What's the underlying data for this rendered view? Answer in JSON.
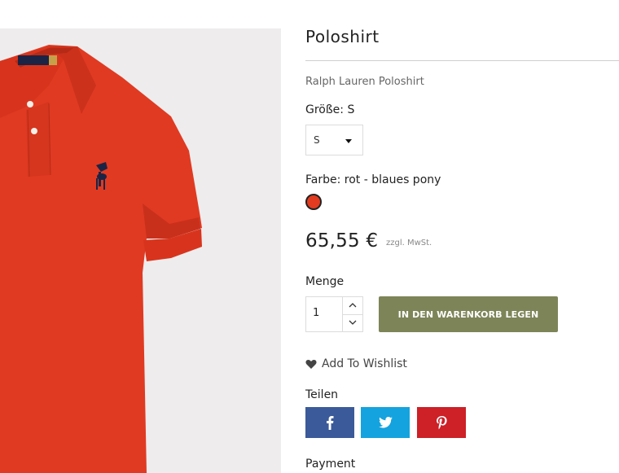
{
  "product": {
    "title": "Poloshirt",
    "subtitle": "Ralph Lauren Poloshirt",
    "image_alt": "Red polo shirt with navy pony logo",
    "shirt_color": "#e03a22",
    "logo_color": "#1b2445"
  },
  "size": {
    "label": "Größe: S",
    "selected": "S"
  },
  "color": {
    "label": "Farbe: rot - blaues pony",
    "swatch": "#e23b1f"
  },
  "price": {
    "amount": "65,55 €",
    "tax_note": "zzgl. MwSt."
  },
  "quantity": {
    "label": "Menge",
    "value": "1"
  },
  "cart": {
    "button_label": "IN DEN WARENKORB LEGEN",
    "button_color": "#7d8458"
  },
  "wishlist": {
    "label": "Add To Wishlist",
    "icon": "heart-icon"
  },
  "share": {
    "label": "Teilen",
    "buttons": [
      {
        "network": "facebook",
        "icon": "facebook-icon",
        "color": "#3b5a9a"
      },
      {
        "network": "twitter",
        "icon": "twitter-icon",
        "color": "#14a3de"
      },
      {
        "network": "pinterest",
        "icon": "pinterest-icon",
        "color": "#cd2027"
      }
    ]
  },
  "payment": {
    "label": "Payment"
  }
}
